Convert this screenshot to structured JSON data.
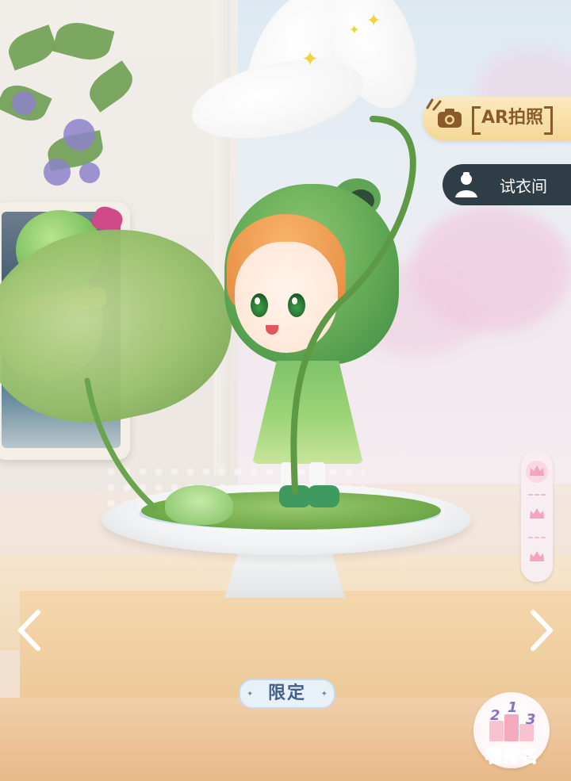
{
  "buttons": {
    "ar_photo": {
      "label": "AR拍照",
      "icon": "camera-icon"
    },
    "fitting_room": {
      "label": "试衣间",
      "icon": "avatar-silhouette-icon"
    },
    "prev": {
      "icon": "chevron-left-icon"
    },
    "next": {
      "icon": "chevron-right-icon"
    },
    "ranking": {
      "label": "看排名",
      "icon": "podium-icon",
      "podium_numbers": [
        "2",
        "1",
        "3"
      ]
    }
  },
  "crown_tabs": [
    {
      "icon": "crown-icon",
      "selected": true
    },
    {
      "icon": "crown-icon",
      "selected": false
    },
    {
      "icon": "crown-icon",
      "selected": false
    }
  ],
  "badge": {
    "label": "限定"
  },
  "colors": {
    "ar_button_bg": "#f4d796",
    "ar_button_text": "#8a5a2b",
    "fitting_button_bg": "#2f3d47",
    "badge_text": "#43608d",
    "rank_text": "#f3a1b3",
    "crown_pink": "#f2a5bd"
  }
}
